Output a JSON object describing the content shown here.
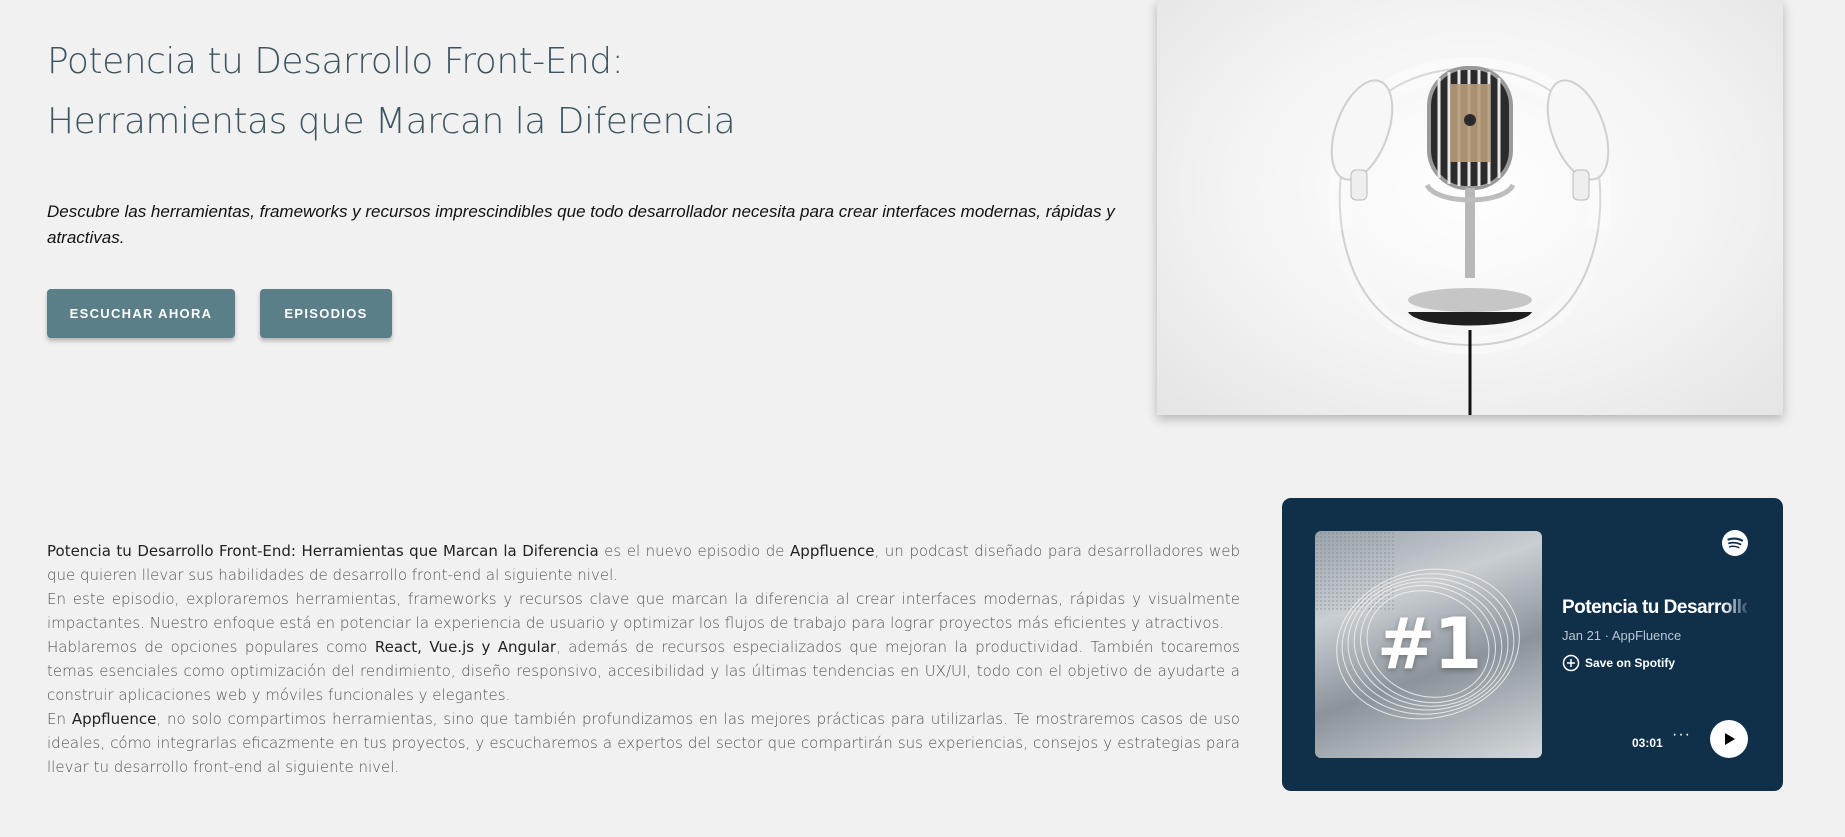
{
  "hero": {
    "title_line1": "Potencia tu Desarrollo Front-End:",
    "title_line2": "Herramientas que Marcan la Diferencia",
    "subtitle": "Descubre las herramientas, frameworks y recursos imprescindibles que todo desarrollador necesita para crear interfaces modernas, rápidas y atractivas.",
    "btn_listen": "ESCUCHAR AHORA",
    "btn_episodes": "EPISODIOS",
    "image_icon": "microphone-with-headphones"
  },
  "description": {
    "p1_bold": "Potencia tu Desarrollo Front-End: Herramientas que Marcan la Diferencia",
    "p1_mid": " es el nuevo episodio de ",
    "p1_brand": "Appfluence",
    "p1_end": ", un podcast diseñado para desarrolladores web que quieren llevar sus habilidades de desarrollo front-end al siguiente nivel.",
    "p2": "En este episodio, exploraremos herramientas, frameworks y recursos clave que marcan la diferencia al crear interfaces modernas, rápidas y visualmente impactantes. Nuestro enfoque está en potenciar la experiencia de usuario y optimizar los flujos de trabajo para lograr proyectos más eficientes y atractivos.",
    "p3_start": "Hablaremos de opciones populares como ",
    "p3_bold": "React, Vue.js y Angular",
    "p3_end": ", además de recursos especializados que mejoran la productividad. También tocaremos temas esenciales como optimización del rendimiento, diseño responsivo, accesibilidad y las últimas tendencias en UX/UI, todo con el objetivo de ayudarte a construir aplicaciones web y móviles funcionales y elegantes.",
    "p4_start": "En ",
    "p4_brand": "Appfluence",
    "p4_end": ", no solo compartimos herramientas, sino que también profundizamos en las mejores prácticas para utilizarlas. Te mostraremos casos de uso ideales, cómo integrarlas eficazmente en tus proyectos, y escucharemos a expertos del sector que compartirán sus experiencias, consejos y estrategias para llevar tu desarrollo front-end al siguiente nivel."
  },
  "player": {
    "cover_text": "#1",
    "title": "Potencia tu Desarrollo Front-End",
    "meta": "Jan 21 · AppFluence",
    "save_label": "Save on Spotify",
    "duration": "03:01",
    "more_label": "···",
    "colors": {
      "card_bg": "#10304a",
      "meta": "#b9c6d3"
    },
    "icons": [
      "spotify-icon",
      "plus-circle-icon",
      "more-icon",
      "play-icon"
    ]
  },
  "theme": {
    "background": "#f1f1f1",
    "button": "#5a7f88",
    "title": "#3d5560"
  }
}
